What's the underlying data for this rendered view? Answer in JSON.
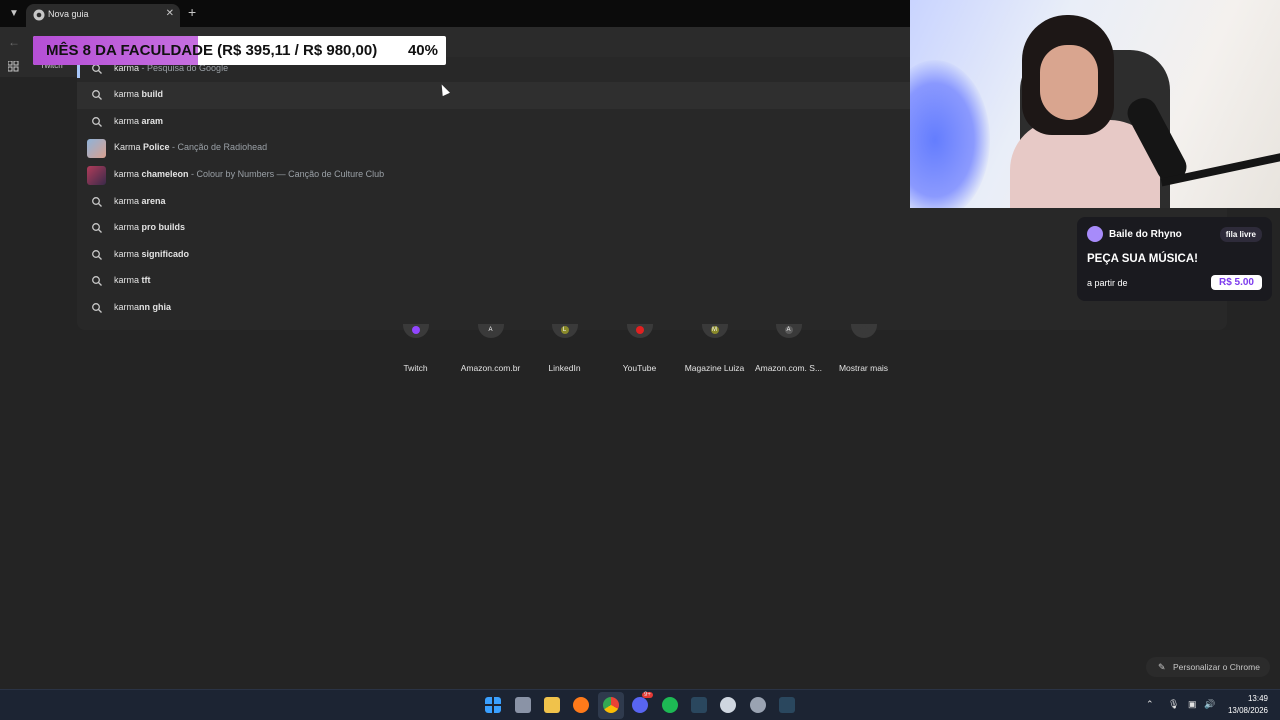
{
  "browser": {
    "tab_title": "Nova guia",
    "bookmark_twitch": "Twitch"
  },
  "goal_banner": {
    "text": "MÊS 8 DA FACULDADE (R$ 395,11 / R$ 980,00)",
    "percent": "40%",
    "progress": 0.4
  },
  "omnibox": {
    "suggestions": [
      {
        "prefix": "karma",
        "bold": "",
        "sub": "Pesquisa do Google",
        "icon": "search-icon"
      },
      {
        "prefix": "karma ",
        "bold": "build",
        "sub": "",
        "icon": "search-icon"
      },
      {
        "prefix": "karma ",
        "bold": "aram",
        "sub": "",
        "icon": "search-icon"
      },
      {
        "prefix": "Karma ",
        "bold": "Police",
        "sub": "Canção de Radiohead",
        "icon": "album-thumbnail"
      },
      {
        "prefix": "karma ",
        "bold": "chameleon",
        "sub": "Colour by Numbers — Canção de Culture Club",
        "icon": "album-thumbnail"
      },
      {
        "prefix": "karma ",
        "bold": "arena",
        "sub": "",
        "icon": "search-icon"
      },
      {
        "prefix": "karma ",
        "bold": "pro builds",
        "sub": "",
        "icon": "search-icon"
      },
      {
        "prefix": "karma ",
        "bold": "significado",
        "sub": "",
        "icon": "search-icon"
      },
      {
        "prefix": "karma ",
        "bold": "tft",
        "sub": "",
        "icon": "search-icon"
      },
      {
        "prefix": "karma",
        "bold": "nn ghia",
        "sub": "",
        "icon": "search-icon"
      }
    ]
  },
  "shortcuts": [
    {
      "label": "Twitch",
      "letter": "",
      "color": "#9146ff"
    },
    {
      "label": "Amazon.com.br",
      "letter": "A",
      "color": "#3a3a3a"
    },
    {
      "label": "LinkedIn",
      "letter": "L",
      "color": "#8a8a2a"
    },
    {
      "label": "YouTube",
      "letter": "",
      "color": "#e02020"
    },
    {
      "label": "Magazine Luiza",
      "letter": "M",
      "color": "#8a8a2a"
    },
    {
      "label": "Amazon.com. S...",
      "letter": "A",
      "color": "#5a5a5a"
    },
    {
      "label": "Mostrar mais",
      "letter": "",
      "color": "#3a3a3a"
    }
  ],
  "music_widget": {
    "name": "Baile do Rhyno",
    "badge": "fila livre",
    "title": "PEÇA SUA MÚSICA!",
    "from_label": "a partir de",
    "price": "R$ 5.00"
  },
  "customize_label": "Personalizar o Chrome",
  "taskbar": {
    "time": "13:49",
    "date": "13/08/2026",
    "discord_badge": "9+"
  }
}
